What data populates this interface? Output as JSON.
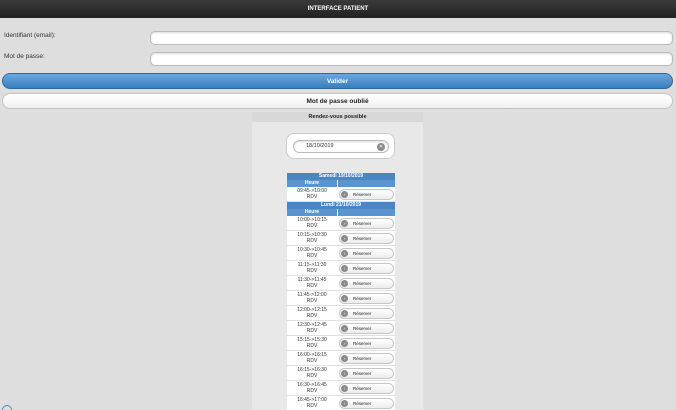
{
  "header": {
    "title": "INTERFACE PATIENT"
  },
  "login": {
    "email_label": "Identifiant (email):",
    "password_label": "Mot de passe:",
    "validate_label": "Valider",
    "forgot_label": "Mot de passe oublié"
  },
  "rdv": {
    "title": "Rendez-vous possible",
    "date_value": "18/10/2019",
    "col_header": "Heure",
    "days": [
      {
        "label": "Samedi 19/10/2019",
        "slots": [
          {
            "time": "09:45->10:00",
            "status": "RDV",
            "action": "Réserver"
          }
        ]
      },
      {
        "label": "Lundi 21/10/2019",
        "slots": [
          {
            "time": "10:00->10:15",
            "status": "RDV",
            "action": "Réserver"
          },
          {
            "time": "10:15->10:30",
            "status": "RDV",
            "action": "Réserver"
          },
          {
            "time": "10:30->10:45",
            "status": "RDV",
            "action": "Réserver"
          },
          {
            "time": "11:15->11:30",
            "status": "RDV",
            "action": "Réserver"
          },
          {
            "time": "11:30->11:45",
            "status": "RDV",
            "action": "Réserver"
          },
          {
            "time": "11:45->12:00",
            "status": "RDV",
            "action": "Réserver"
          },
          {
            "time": "12:00->12:15",
            "status": "RDV",
            "action": "Réserver"
          },
          {
            "time": "12:30->12:45",
            "status": "RDV",
            "action": "Réserver"
          },
          {
            "time": "15:15->15:30",
            "status": "RDV",
            "action": "Réserver"
          },
          {
            "time": "16:00->16:15",
            "status": "RDV",
            "action": "Réserver"
          },
          {
            "time": "16:15->16:30",
            "status": "RDV",
            "action": "Réserver"
          },
          {
            "time": "16:30->16:45",
            "status": "RDV",
            "action": "Réserver"
          },
          {
            "time": "16:45->17:00",
            "status": "RDV",
            "action": "Réserver"
          }
        ]
      }
    ]
  },
  "icons": {
    "clear": "x-circle-icon",
    "reserve": "chevron-circle-icon"
  },
  "colors": {
    "accent": "#3a7dbe",
    "topbar": "#2b2b2b",
    "background": "#dedede"
  }
}
